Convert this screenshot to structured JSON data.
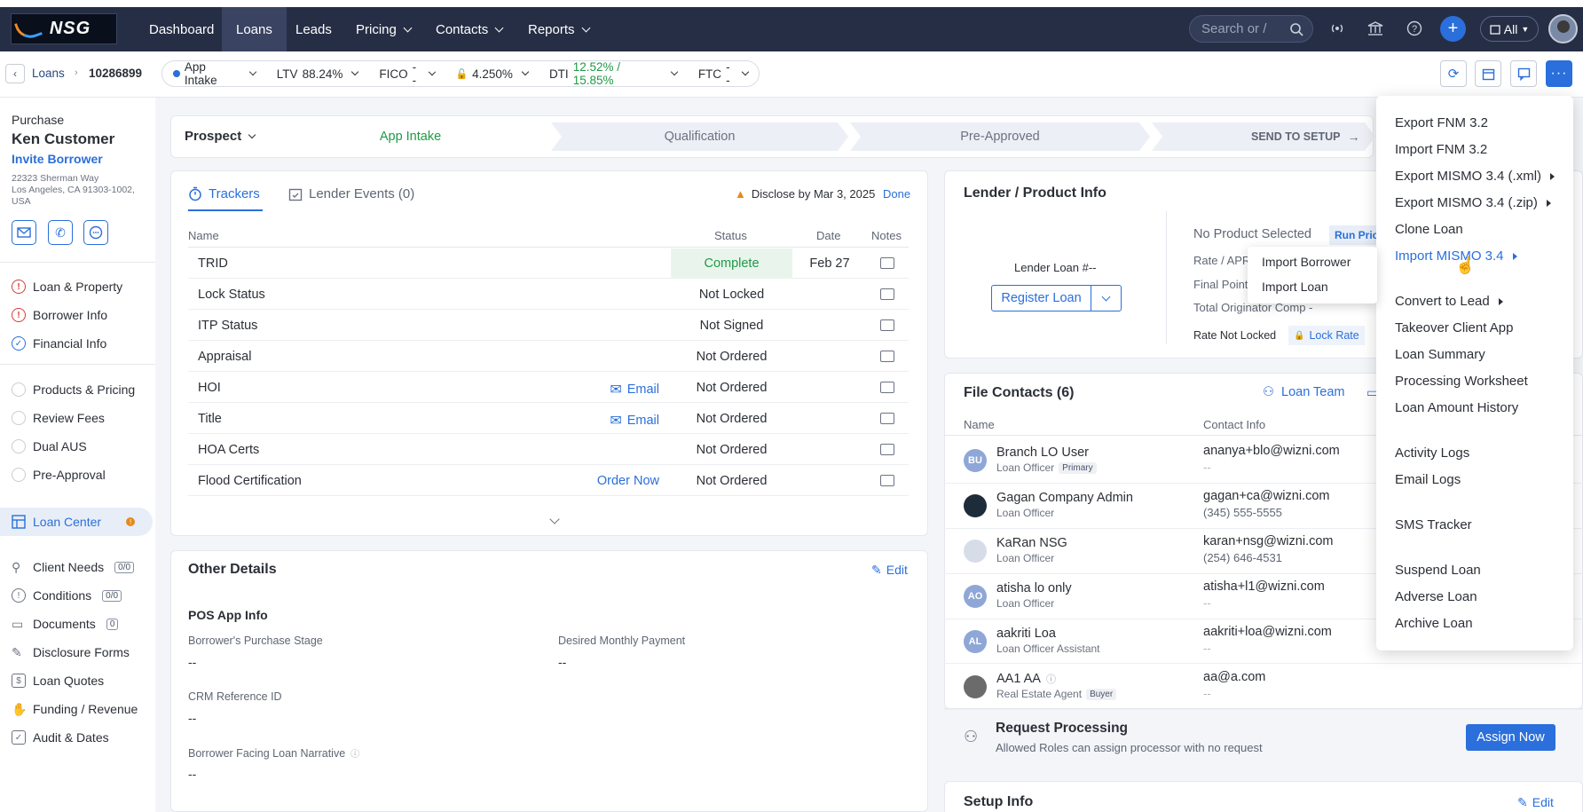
{
  "nav": {
    "logo": "NSG",
    "items": [
      {
        "label": "Dashboard",
        "dropdown": false
      },
      {
        "label": "Loans",
        "dropdown": false,
        "active": true
      },
      {
        "label": "Leads",
        "dropdown": false
      },
      {
        "label": "Pricing",
        "dropdown": true
      },
      {
        "label": "Contacts",
        "dropdown": true
      },
      {
        "label": "Reports",
        "dropdown": true
      }
    ],
    "search_placeholder": "Search or /",
    "all_label": "All",
    "icons": [
      "broadcast-icon",
      "bank-icon",
      "help-icon",
      "plus-icon"
    ]
  },
  "subheader": {
    "crumb_loans": "Loans",
    "loan_number": "10286899",
    "stage_pill": "App Intake",
    "ltv_label": "LTV",
    "ltv_value": "88.24%",
    "fico_label": "FICO",
    "fico_value": "--",
    "rate_value": "4.250%",
    "dti_label": "DTI",
    "dti_value": "12.52% / 15.85%",
    "ftc_label": "FTC",
    "ftc_value": "--"
  },
  "sidebar": {
    "loan_type": "Purchase",
    "borrower_name": "Ken Customer",
    "invite": "Invite Borrower",
    "address": "22323 Sherman Way\nLos Angeles, CA 91303-1002, USA",
    "section1": [
      {
        "label": "Loan & Property",
        "state": "warn"
      },
      {
        "label": "Borrower Info",
        "state": "warn"
      },
      {
        "label": "Financial Info",
        "state": "ok"
      }
    ],
    "section2": [
      {
        "label": "Products & Pricing"
      },
      {
        "label": "Review Fees"
      },
      {
        "label": "Dual AUS"
      },
      {
        "label": "Pre-Approval"
      }
    ],
    "loan_center": "Loan Center",
    "section3": [
      {
        "label": "Client Needs",
        "badge": "0/0"
      },
      {
        "label": "Conditions",
        "badge": "0/0"
      },
      {
        "label": "Documents",
        "badge": "0"
      },
      {
        "label": "Disclosure Forms",
        "badge": ""
      },
      {
        "label": "Loan Quotes",
        "badge": ""
      },
      {
        "label": "Funding / Revenue",
        "badge": ""
      },
      {
        "label": "Audit & Dates",
        "badge": ""
      }
    ]
  },
  "stages": {
    "prospect": "Prospect",
    "items": [
      "App Intake",
      "Qualification",
      "Pre-Approved"
    ],
    "send": "SEND TO SETUP"
  },
  "trackers": {
    "tab_trackers": "Trackers",
    "tab_events": "Lender Events (0)",
    "disclose": "Disclose by Mar 3, 2025",
    "done": "Done",
    "headers": {
      "name": "Name",
      "status": "Status",
      "date": "Date",
      "notes": "Notes"
    },
    "rows": [
      {
        "name": "TRID",
        "action": "",
        "status": "Complete",
        "date": "Feb 27"
      },
      {
        "name": "Lock Status",
        "action": "",
        "status": "Not Locked",
        "date": ""
      },
      {
        "name": "ITP Status",
        "action": "",
        "status": "Not Signed",
        "date": ""
      },
      {
        "name": "Appraisal",
        "action": "",
        "status": "Not Ordered",
        "date": ""
      },
      {
        "name": "HOI",
        "action": "Email",
        "status": "Not Ordered",
        "date": ""
      },
      {
        "name": "Title",
        "action": "Email",
        "status": "Not Ordered",
        "date": ""
      },
      {
        "name": "HOA Certs",
        "action": "",
        "status": "Not Ordered",
        "date": ""
      },
      {
        "name": "Flood Certification",
        "action": "Order Now",
        "status": "Not Ordered",
        "date": ""
      }
    ]
  },
  "other": {
    "title": "Other Details",
    "edit": "Edit",
    "pos_title": "POS App Info",
    "f1_label": "Borrower's Purchase Stage",
    "f1_value": "--",
    "f2_label": "Desired Monthly Payment",
    "f2_value": "--",
    "f3_label": "CRM Reference ID",
    "f3_value": "--",
    "f4_label": "Borrower Facing Loan Narrative",
    "f4_value": "--"
  },
  "lender": {
    "title": "Lender / Product Info",
    "lender_loan": "Lender Loan #--",
    "register": "Register Loan",
    "no_product": "No Product Selected",
    "run_pricing": "Run Prici",
    "rate_apr": "Rate / APR",
    "final_points": "Final Points",
    "total_comp": "Total Originator Comp -",
    "rate_not_locked": "Rate Not Locked",
    "lock_rate": "Lock Rate"
  },
  "contacts": {
    "title": "File Contacts (6)",
    "loan_team": "Loan Team",
    "col_name": "Name",
    "col_info": "Contact Info",
    "rows": [
      {
        "initials": "BU",
        "name": "Branch LO User",
        "role": "Loan Officer",
        "tag": "Primary",
        "email": "ananya+blo@wizni.com",
        "phone": "--"
      },
      {
        "initials": "",
        "name": "Gagan Company Admin",
        "role": "Loan Officer",
        "tag": "",
        "email": "gagan+ca@wizni.com",
        "phone": "(345) 555-5555"
      },
      {
        "initials": "",
        "name": "KaRan NSG",
        "role": "Loan Officer",
        "tag": "",
        "email": "karan+nsg@wizni.com",
        "phone": "(254) 646-4531"
      },
      {
        "initials": "AO",
        "name": "atisha lo only",
        "role": "Loan Officer",
        "tag": "",
        "email": "atisha+l1@wizni.com",
        "phone": "--"
      },
      {
        "initials": "AL",
        "name": "aakriti Loa",
        "role": "Loan Officer Assistant",
        "tag": "",
        "email": "aakriti+loa@wizni.com",
        "phone": "--"
      },
      {
        "initials": "",
        "name": "AA1 AA",
        "role": "Real Estate Agent",
        "tag": "Buyer",
        "email": "aa@a.com",
        "phone": "--"
      }
    ],
    "request_title": "Request Processing",
    "request_sub": "Allowed Roles can assign processor with no request",
    "assign": "Assign Now"
  },
  "setup": {
    "title": "Setup Info",
    "edit": "Edit"
  },
  "menu": {
    "items": [
      {
        "label": "Export FNM 3.2",
        "arrow": false
      },
      {
        "label": "Import FNM 3.2",
        "arrow": false
      },
      {
        "label": "Export MISMO 3.4 (.xml)",
        "arrow": true
      },
      {
        "label": "Export MISMO 3.4 (.zip)",
        "arrow": true
      },
      {
        "label": "Clone Loan",
        "arrow": false
      },
      {
        "label": "Import MISMO 3.4",
        "arrow": true,
        "highlight": true
      },
      {
        "label": "Convert to Lead",
        "arrow": true
      },
      {
        "label": "Takeover Client App",
        "arrow": false
      },
      {
        "label": "Loan Summary",
        "arrow": false
      },
      {
        "label": "Processing Worksheet",
        "arrow": false
      },
      {
        "label": "Loan Amount History",
        "arrow": false
      },
      {
        "label": "Activity Logs",
        "arrow": false
      },
      {
        "label": "Email Logs",
        "arrow": false
      },
      {
        "label": "SMS Tracker",
        "arrow": false
      },
      {
        "label": "Suspend Loan",
        "arrow": false
      },
      {
        "label": "Adverse Loan",
        "arrow": false
      },
      {
        "label": "Archive Loan",
        "arrow": false
      }
    ],
    "submenu": [
      "Import Borrower",
      "Import Loan"
    ]
  },
  "colors": {
    "accent": "#2a6fdb",
    "nav": "#262e45",
    "success": "#1f9a45",
    "warn": "#d83a3a"
  }
}
